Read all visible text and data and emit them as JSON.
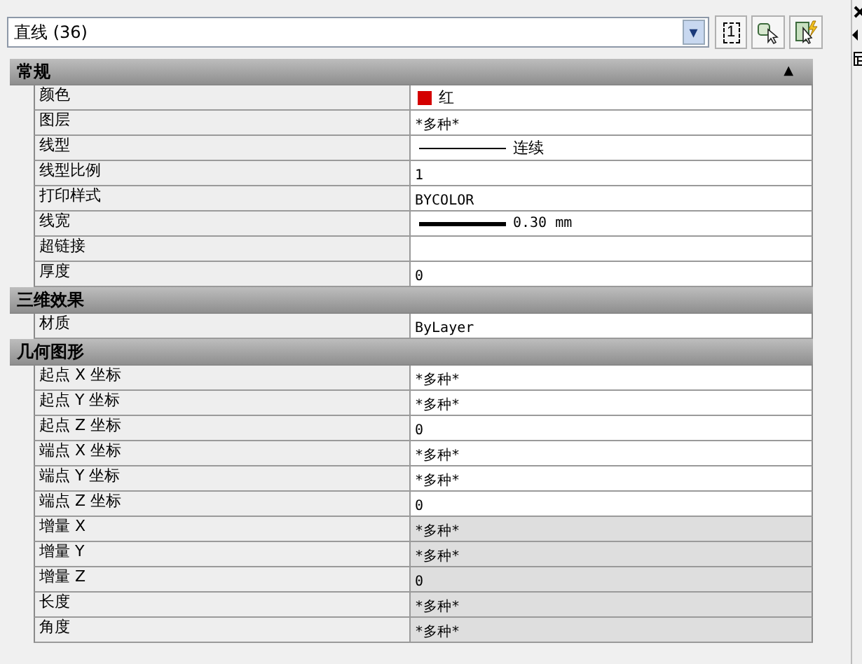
{
  "selector": {
    "value": "直线 (36)",
    "arrow": "▾"
  },
  "toolbar": [
    {
      "kind": "one",
      "label": "1"
    },
    {
      "kind": "select"
    },
    {
      "kind": "quick"
    }
  ],
  "sections": [
    {
      "title": "常规",
      "arrow": "▲",
      "rows": [
        {
          "label": "颜色",
          "kind": "color",
          "value": "红",
          "color": "#d40000",
          "readonly": false
        },
        {
          "label": "图层",
          "kind": "text",
          "value": "*多种*",
          "readonly": false
        },
        {
          "label": "线型",
          "kind": "linetype",
          "value": "连续",
          "readonly": false
        },
        {
          "label": "线型比例",
          "kind": "text",
          "value": "1",
          "readonly": false
        },
        {
          "label": "打印样式",
          "kind": "text",
          "value": "BYCOLOR",
          "readonly": false
        },
        {
          "label": "线宽",
          "kind": "lineweight",
          "value": "0.30 mm",
          "readonly": false
        },
        {
          "label": "超链接",
          "kind": "empty",
          "readonly": false
        },
        {
          "label": "厚度",
          "kind": "text",
          "value": "0",
          "readonly": false
        }
      ]
    },
    {
      "title": "三维效果",
      "rows": [
        {
          "label": "材质",
          "kind": "text",
          "value": "ByLayer",
          "readonly": false
        }
      ]
    },
    {
      "title": "几何图形",
      "rows": [
        {
          "label": "起点 X 坐标",
          "kind": "text",
          "value": "*多种*",
          "readonly": false
        },
        {
          "label": "起点 Y 坐标",
          "kind": "text",
          "value": "*多种*",
          "readonly": false
        },
        {
          "label": "起点 Z 坐标",
          "kind": "text",
          "value": "0",
          "readonly": false
        },
        {
          "label": "端点 X 坐标",
          "kind": "text",
          "value": "*多种*",
          "readonly": false
        },
        {
          "label": "端点 Y 坐标",
          "kind": "text",
          "value": "*多种*",
          "readonly": false
        },
        {
          "label": "端点 Z 坐标",
          "kind": "text",
          "value": "0",
          "readonly": false
        },
        {
          "label": "增量 X",
          "kind": "text",
          "value": "*多种*",
          "readonly": true
        },
        {
          "label": "增量 Y",
          "kind": "text",
          "value": "*多种*",
          "readonly": true
        },
        {
          "label": "增量 Z",
          "kind": "text",
          "value": "0",
          "readonly": true
        },
        {
          "label": "长度",
          "kind": "text",
          "value": "*多种*",
          "readonly": true
        },
        {
          "label": "角度",
          "kind": "text",
          "value": "*多种*",
          "readonly": true
        }
      ]
    }
  ]
}
